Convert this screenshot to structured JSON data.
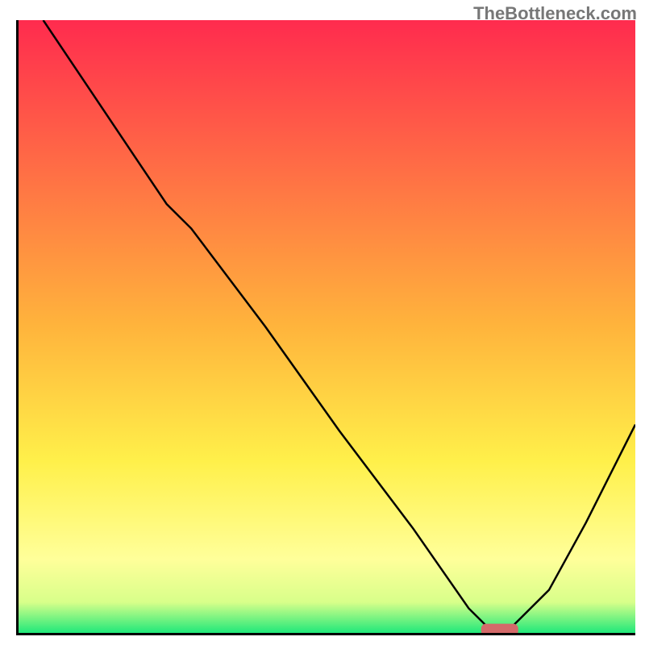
{
  "watermark": "TheBottleneck.com",
  "chart_data": {
    "type": "line",
    "title": "",
    "xlabel": "",
    "ylabel": "",
    "xlim": [
      0,
      100
    ],
    "ylim": [
      0,
      100
    ],
    "grid": false,
    "legend": false,
    "background_gradient": {
      "stops": [
        {
          "offset": 0,
          "color": "#ff2b4e"
        },
        {
          "offset": 50,
          "color": "#ffb43c"
        },
        {
          "offset": 72,
          "color": "#fff04a"
        },
        {
          "offset": 88,
          "color": "#ffff9a"
        },
        {
          "offset": 95,
          "color": "#d8ff8a"
        },
        {
          "offset": 100,
          "color": "#20e87a"
        }
      ]
    },
    "series": [
      {
        "name": "bottleneck-curve",
        "color": "#000000",
        "x": [
          4,
          12,
          20,
          24,
          28,
          40,
          52,
          64,
          73,
          76,
          80,
          86,
          92,
          100
        ],
        "y": [
          100,
          88,
          76,
          70,
          66,
          50,
          33,
          17,
          4,
          1,
          1,
          7,
          18,
          34
        ]
      }
    ],
    "markers": [
      {
        "name": "optimal-marker",
        "shape": "rounded-bar",
        "x": 78,
        "y": 0.5,
        "width_pct": 6,
        "height_pct": 2,
        "color": "#d46a6a"
      }
    ]
  }
}
